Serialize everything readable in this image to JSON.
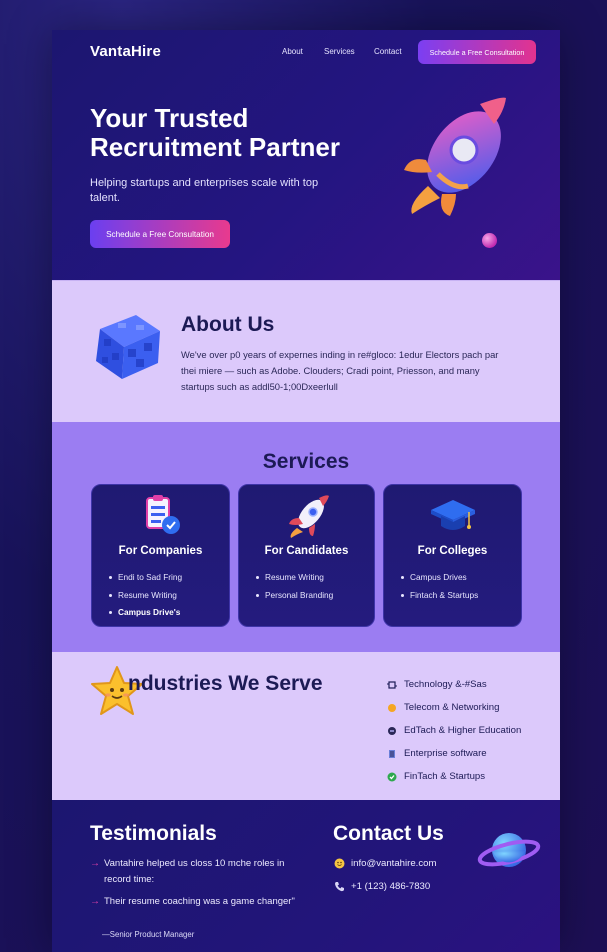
{
  "header": {
    "logo": "VantaHire",
    "nav": [
      "About",
      "Services",
      "Contact"
    ],
    "cta": "Schedule a Free Consultation"
  },
  "hero": {
    "title": "Your Trusted Recruitment Partner",
    "subtitle": "Helping startups and enterprises scale with top talent.",
    "cta": "Schedule a Free Consultation"
  },
  "about": {
    "title": "About Us",
    "text": "We've over p0 years of expernes inding in re#gloco: 1edur Electors pach par thei miere — such as Adobe. Clouders; Cradi point, Priesson, and many startups such as addl50-1;00Dxeerlull"
  },
  "services": {
    "title": "Services",
    "cards": [
      {
        "title": "For Companies",
        "items": [
          "Endi to Sad Fring",
          "Resume Writing",
          "Campus Drive's"
        ]
      },
      {
        "title": "For Candidates",
        "items": [
          "Resume Writing",
          "Personal Branding"
        ]
      },
      {
        "title": "For Colleges",
        "items": [
          "Campus Drives",
          "Fintach & Startups"
        ]
      }
    ]
  },
  "industries": {
    "title": "ndustries We Serve",
    "items": [
      {
        "label": "Technology &-#Sas",
        "icon": "chip-icon"
      },
      {
        "label": "Telecom & Networking",
        "icon": "signal-icon"
      },
      {
        "label": "EdTach & Higher Education",
        "icon": "graduation-icon"
      },
      {
        "label": "Enterprise software",
        "icon": "building-icon"
      },
      {
        "label": "FinTach & Startups",
        "icon": "check-icon"
      }
    ]
  },
  "testimonials": {
    "title": "Testimonials",
    "quotes": [
      "Vantahire helped us closs 10 mche roles in record time:",
      "Their resume coaching was a game changer\""
    ],
    "author": "—Senior Product Manager"
  },
  "contact": {
    "title": "Contact Us",
    "email": "info@vantahire.com",
    "phone": "+1 (123) 486-7830"
  },
  "colors": {
    "accent_start": "#7b3ff2",
    "accent_end": "#e2338f",
    "hero_bg": "#1c1670",
    "about_bg": "#dcc9fb",
    "services_bg": "#9b7df2",
    "heading": "#1c1a55"
  }
}
